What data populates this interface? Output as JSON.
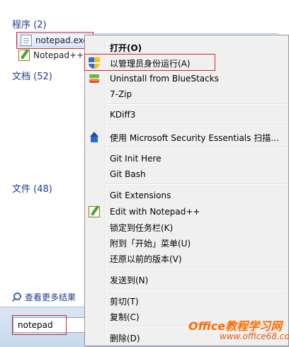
{
  "results": {
    "programs_title": "程序 (2)",
    "programs": [
      {
        "label": "notepad.exe",
        "icon": "notepad-file-icon"
      },
      {
        "label": "Notepad++",
        "icon": "notepad-plus-plus-icon"
      }
    ],
    "documents_title": "文档 (52)",
    "files_title": "文件 (48)",
    "see_more": "查看更多结果",
    "search_value": "notepad"
  },
  "context_menu": {
    "items": [
      {
        "label": "打开(O)",
        "bold": true
      },
      {
        "label": "以管理员身份运行(A)",
        "icon": "uac-shield-icon"
      },
      {
        "label": "Uninstall from BlueStacks",
        "icon": "bluestacks-icon"
      },
      {
        "label": "7-Zip"
      },
      {
        "label": "KDiff3"
      },
      {
        "label": "使用 Microsoft Security Essentials 扫描...",
        "icon": "security-essentials-icon"
      },
      {
        "label": "Git Init Here"
      },
      {
        "label": "Git Bash"
      },
      {
        "label": "Git Extensions"
      },
      {
        "label": "Edit with Notepad++",
        "icon": "notepad-plus-plus-icon"
      },
      {
        "label": "锁定到任务栏(K)"
      },
      {
        "label": "附到「开始」菜单(U)"
      },
      {
        "label": "还原以前的版本(V)"
      },
      {
        "label": "发送到(N)"
      },
      {
        "label": "剪切(T)"
      },
      {
        "label": "复制(C)"
      },
      {
        "label": "删除(D)"
      }
    ]
  },
  "watermark": {
    "line1": "Office教程学习网",
    "line2": "www.office68.com"
  },
  "colors": {
    "highlight_box": "#d9232d",
    "group_title": "#1e3a8c",
    "menu_bg": "#f0f0f0"
  }
}
